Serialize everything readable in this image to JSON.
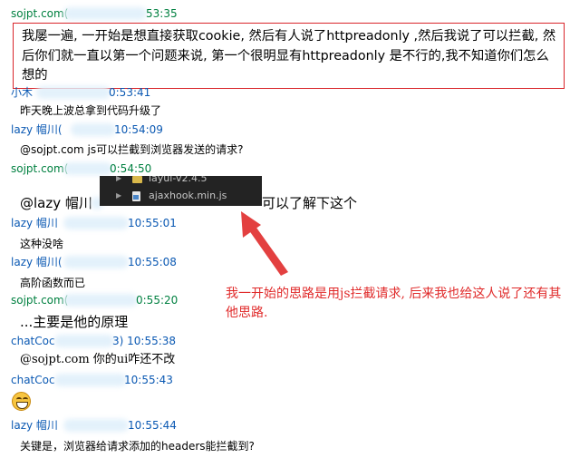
{
  "messages": [
    {
      "sender_prefix": "sojpt.com(",
      "time_suffix": "53:35",
      "body": "我屡一遍, 一开始是想直接获取cookie, 然后有人说了httpreadonly ,然后我说了可以拦截, 然后你们就一直以第一个问题来说, 第一个很明显有httpreadonly 是不行的,我不知道你们怎么想的"
    },
    {
      "sender_prefix": "小木",
      "time_suffix": "0:53:41",
      "body": "昨天晚上波总拿到代码升级了"
    },
    {
      "sender_prefix": "lazy 帽川(",
      "time_suffix": "10:54:09",
      "body": "@sojpt.com js可以拦截到浏览器发送的请求?"
    },
    {
      "sender_prefix": "sojpt.com(",
      "time_suffix": "0:54:50",
      "body_prefix": "@lazy 帽川",
      "body_suffix": "可以了解下这个"
    },
    {
      "sender_prefix": "lazy 帽川",
      "time_suffix": "10:55:01",
      "body": "这种没啥"
    },
    {
      "sender_prefix": "lazy 帽川(",
      "time_suffix": "10:55:08",
      "body": "高阶函数而已"
    },
    {
      "sender_prefix": "sojpt.com(",
      "time_suffix": "0:55:20",
      "body": "...主要是他的原理"
    },
    {
      "sender_prefix": "chatCoc",
      "time_suffix": "3) 10:55:38",
      "body": "@sojpt.com 你的ui咋还不改"
    },
    {
      "sender_prefix": "chatCoc",
      "time_suffix": "10:55:43",
      "emoji": "grinning-face"
    },
    {
      "sender_prefix": "lazy 帽川",
      "time_suffix": "10:55:44",
      "body": "关键是，浏览器给请求添加的headers能拦截到?"
    }
  ],
  "popup": {
    "items": [
      {
        "label": "layui-v2.4.5",
        "icon": "folder-icon"
      },
      {
        "label": "ajaxhook.min.js",
        "icon": "js-file-icon"
      }
    ]
  },
  "annotation": {
    "text": "我一开始的思路是用js拦截请求, 后来我也给这人说了还有其他思路.",
    "color": "#e02a2a"
  },
  "colors": {
    "sender_green": "#008040",
    "sender_blue": "#0b59b3",
    "highlight_border": "#d9262b",
    "popup_bg": "#232323"
  }
}
